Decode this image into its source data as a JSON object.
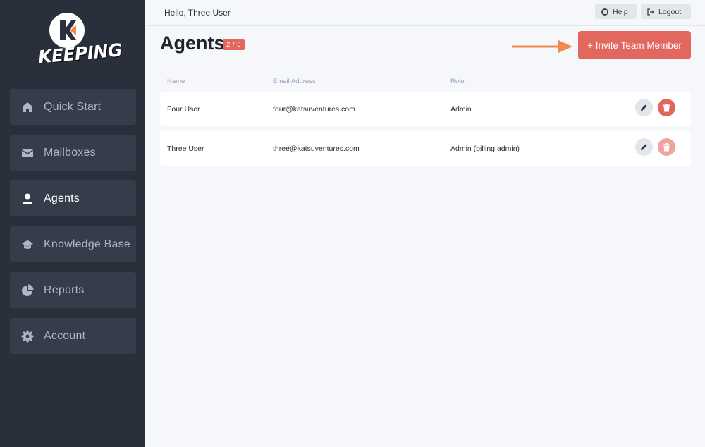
{
  "brand": {
    "logo_text": "KEEPING",
    "logo_letter": "K"
  },
  "header": {
    "greeting": "Hello, Three User",
    "help_label": "Help",
    "logout_label": "Logout"
  },
  "sidebar": {
    "items": [
      {
        "label": "Quick Start",
        "icon": "home-icon",
        "active": false
      },
      {
        "label": "Mailboxes",
        "icon": "envelope-icon",
        "active": false
      },
      {
        "label": "Agents",
        "icon": "user-icon",
        "active": true
      },
      {
        "label": "Knowledge Base",
        "icon": "graduation-cap-icon",
        "active": false
      },
      {
        "label": "Reports",
        "icon": "pie-chart-icon",
        "active": false
      },
      {
        "label": "Account",
        "icon": "gear-icon",
        "active": false
      }
    ]
  },
  "main": {
    "title": "Agents",
    "badge": "2 / 5",
    "invite_label": "+ Invite Team Member",
    "columns": [
      "Name",
      "Email Address",
      "Role"
    ],
    "rows": [
      {
        "name": "Four User",
        "email": "four@katsuventures.com",
        "role": "Admin",
        "delete_disabled": false
      },
      {
        "name": "Three User",
        "email": "three@katsuventures.com",
        "role": "Admin (billing admin)",
        "delete_disabled": true
      }
    ]
  },
  "colors": {
    "sidebar_bg": "#2a303b",
    "nav_item_bg": "#363d4a",
    "accent": "#e2675f",
    "arrow": "#ef8a4c",
    "page_bg": "#f5f7fa"
  }
}
